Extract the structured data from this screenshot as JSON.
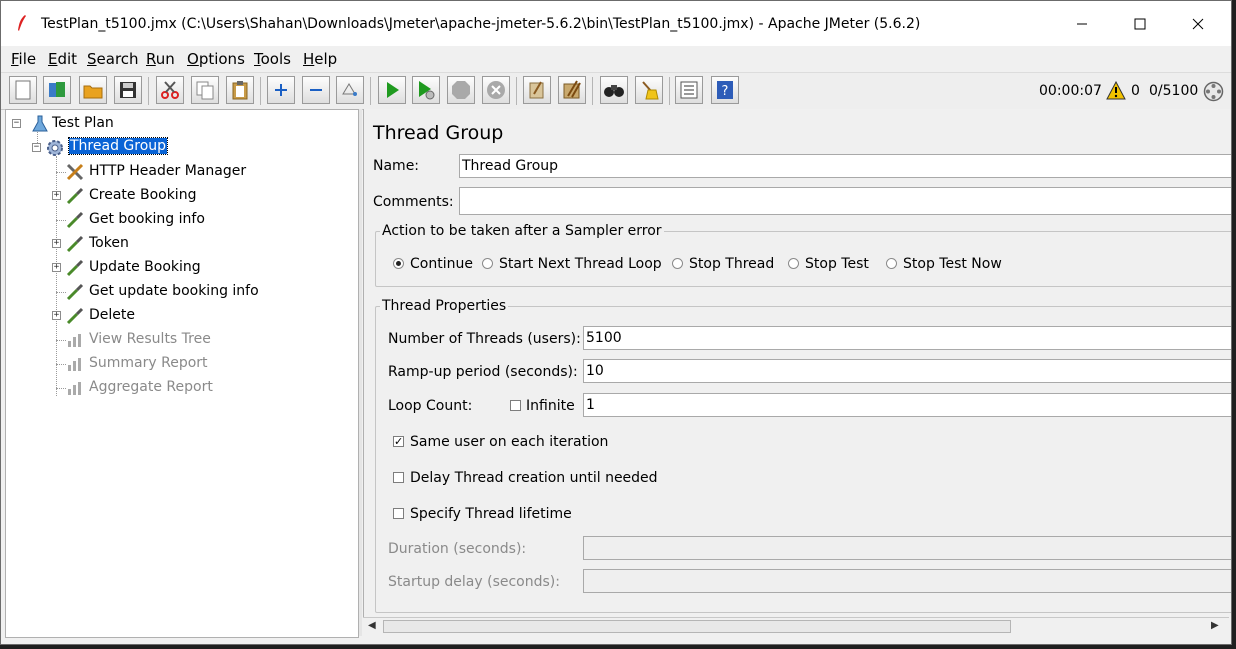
{
  "window": {
    "title": "TestPlan_t5100.jmx (C:\\Users\\Shahan\\Downloads\\Jmeter\\apache-jmeter-5.6.2\\bin\\TestPlan_t5100.jmx) - Apache JMeter (5.6.2)",
    "minimize": "—",
    "maximize": "☐",
    "close": "✕"
  },
  "menu": [
    {
      "first": "F",
      "rest": "ile"
    },
    {
      "first": "E",
      "rest": "dit"
    },
    {
      "first": "S",
      "rest": "earch"
    },
    {
      "first": "R",
      "rest": "un"
    },
    {
      "first": "O",
      "rest": "ptions"
    },
    {
      "first": "T",
      "rest": "ools"
    },
    {
      "first": "H",
      "rest": "elp"
    }
  ],
  "toolbar": {
    "icons": [
      "new-icon",
      "templates-icon",
      "open-icon",
      "save-icon",
      "cut-icon",
      "copy-icon",
      "paste-icon",
      "expand-icon",
      "collapse-icon",
      "toggle-icon",
      "start-icon",
      "start-no-pause-icon",
      "stop-icon",
      "shutdown-icon",
      "clear-icon",
      "clear-all-icon",
      "search-icon",
      "reset-search-icon",
      "function-helper-icon",
      "help-icon"
    ],
    "elapsed": "00:00:07",
    "warning_count": "0",
    "threads": "0/5100"
  },
  "tree": {
    "items": [
      {
        "label": "Test Plan",
        "icon": "test-plan-icon",
        "state": "normal"
      },
      {
        "label": "Thread Group",
        "icon": "thread-group-gear-icon",
        "state": "selected"
      },
      {
        "label": "HTTP Header Manager",
        "icon": "config-tools-icon",
        "state": "normal"
      },
      {
        "label": "Create Booking",
        "icon": "sampler-pipette-icon",
        "state": "normal"
      },
      {
        "label": "Get booking info",
        "icon": "sampler-pipette-icon",
        "state": "normal"
      },
      {
        "label": "Token",
        "icon": "sampler-pipette-icon",
        "state": "normal"
      },
      {
        "label": "Update Booking",
        "icon": "sampler-pipette-icon",
        "state": "normal"
      },
      {
        "label": "Get update booking info",
        "icon": "sampler-pipette-icon",
        "state": "normal"
      },
      {
        "label": "Delete",
        "icon": "sampler-pipette-icon",
        "state": "normal"
      },
      {
        "label": "View Results Tree",
        "icon": "listener-chart-icon",
        "state": "disabled"
      },
      {
        "label": "Summary Report",
        "icon": "listener-chart-icon",
        "state": "disabled"
      },
      {
        "label": "Aggregate Report",
        "icon": "listener-chart-icon",
        "state": "disabled"
      }
    ],
    "expander_collapsed": "+",
    "expander_expanded": "−"
  },
  "panel": {
    "heading": "Thread Group",
    "name_label": "Name:",
    "name_value": "Thread Group",
    "comments_label": "Comments:",
    "comments_value": "",
    "error_action": {
      "legend": "Action to be taken after a Sampler error",
      "options": [
        "Continue",
        "Start Next Thread Loop",
        "Stop Thread",
        "Stop Test",
        "Stop Test Now"
      ],
      "selected": "Continue"
    },
    "thread_props": {
      "legend": "Thread Properties",
      "threads_label": "Number of Threads (users):",
      "threads_value": "5100",
      "rampup_label": "Ramp-up period (seconds):",
      "rampup_value": "10",
      "loop_label": "Loop Count:",
      "infinite_label": "Infinite",
      "infinite_checked": false,
      "loop_value": "1",
      "same_user_label": "Same user on each iteration",
      "same_user_checked": true,
      "delay_label": "Delay Thread creation until needed",
      "delay_checked": false,
      "lifetime_label": "Specify Thread lifetime",
      "lifetime_checked": false,
      "duration_label": "Duration (seconds):",
      "duration_value": "",
      "startup_label": "Startup delay (seconds):",
      "startup_value": ""
    }
  },
  "colors": {
    "selection": "#0a64d6",
    "run_green": "#1f9a1f",
    "warning": "#f2c200"
  }
}
